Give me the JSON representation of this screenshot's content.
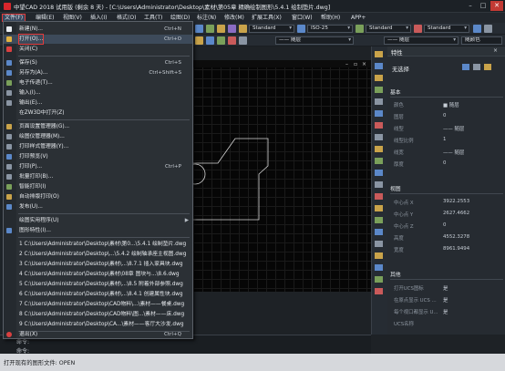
{
  "window": {
    "title": "中望CAD 2018 试用版 (剩余 8 天) - [C:\\Users\\Administrator\\Desktop\\素材\\第05章 精确绘制图形\\5.4.1 绘制垫片.dwg]",
    "minimize": "–",
    "maximize": "□",
    "close": "✕"
  },
  "menubar": {
    "items": [
      "文件(F)",
      "编辑(E)",
      "视图(V)",
      "插入(I)",
      "格式(O)",
      "工具(T)",
      "绘图(D)",
      "标注(N)",
      "修改(M)",
      "扩展工具(X)",
      "窗口(W)",
      "帮助(H)",
      "APP+"
    ]
  },
  "toolbar": {
    "text_style": "Standard",
    "dim_style": "ISO-25",
    "table_style": "Standard",
    "multileader_style": "Standard",
    "layer_linetype": "—— 随层",
    "layer_lineweight": "—— 随层",
    "color_value": "随颜色"
  },
  "file_menu": {
    "items": [
      {
        "label": "新建(N)...",
        "shortcut": "Ctrl+N",
        "icon": "new-file-icon"
      },
      {
        "label": "打开(O)...",
        "shortcut": "Ctrl+O",
        "icon": "open-folder-icon"
      },
      {
        "label": "关闭(C)",
        "shortcut": "",
        "icon": "close-file-icon"
      },
      {
        "label": "保存(S)",
        "shortcut": "Ctrl+S",
        "icon": "save-icon"
      },
      {
        "label": "另存为(A)...",
        "shortcut": "Ctrl+Shift+S",
        "icon": "save-as-icon"
      },
      {
        "label": "电子传递(T)...",
        "shortcut": "",
        "icon": "etransmit-icon"
      },
      {
        "label": "输入(I)...",
        "shortcut": "",
        "icon": "import-icon"
      },
      {
        "label": "输出(E)...",
        "shortcut": "",
        "icon": "export-icon"
      },
      {
        "label": "在ZW3D中打开(Z)",
        "shortcut": "",
        "icon": ""
      },
      {
        "label": "页面设置管理器(G)...",
        "shortcut": "",
        "icon": "page-setup-icon"
      },
      {
        "label": "绘图仪管理器(M)...",
        "shortcut": "",
        "icon": "plotter-icon"
      },
      {
        "label": "打印样式管理器(Y)...",
        "shortcut": "",
        "icon": "plot-style-icon"
      },
      {
        "label": "打印预览(V)",
        "shortcut": "",
        "icon": "preview-icon"
      },
      {
        "label": "打印(P)...",
        "shortcut": "Ctrl+P",
        "icon": "print-icon"
      },
      {
        "label": "批量打印(B)...",
        "shortcut": "",
        "icon": "batch-plot-icon"
      },
      {
        "label": "智能打印(I)",
        "shortcut": "",
        "icon": "smart-plot-icon"
      },
      {
        "label": "自动排版打印(O)",
        "shortcut": "",
        "icon": "auto-layout-plot-icon"
      },
      {
        "label": "发布(U)...",
        "shortcut": "",
        "icon": "publish-icon"
      },
      {
        "label": "绘图实用程序(U)",
        "shortcut": "",
        "icon": "",
        "submenu": true
      },
      {
        "label": "图形特性(I)...",
        "shortcut": "",
        "icon": "properties-icon"
      },
      {
        "label": "1 C:\\Users\\Administrator\\Desktop\\素材\\第0...\\5.4.1 绘制垫片.dwg",
        "shortcut": "",
        "icon": ""
      },
      {
        "label": "2 C:\\Users\\Administrator\\Desktop\\...\\5.4.2 绘制轴承座主视图.dwg",
        "shortcut": "",
        "icon": ""
      },
      {
        "label": "3 C:\\Users\\Administrator\\Desktop\\素材\\...\\8.7.1  插入家具块.dwg",
        "shortcut": "",
        "icon": ""
      },
      {
        "label": "4 C:\\Users\\Administrator\\Desktop\\素材\\08章 图块与...\\8.6.dwg",
        "shortcut": "",
        "icon": ""
      },
      {
        "label": "5 C:\\Users\\Administrator\\Desktop\\素材\\...\\8.5  附着外部参照.dwg",
        "shortcut": "",
        "icon": ""
      },
      {
        "label": "6 C:\\Users\\Administrator\\Desktop\\素材\\...\\8.4.1  创建属性块.dwg",
        "shortcut": "",
        "icon": ""
      },
      {
        "label": "7 C:\\Users\\Administrator\\Desktop\\CAD物料\\...\\素材——餐桌.dwg",
        "shortcut": "",
        "icon": ""
      },
      {
        "label": "8 C:\\Users\\Administrator\\Desktop\\CAD物料\\图...\\素材——床.dwg",
        "shortcut": "",
        "icon": ""
      },
      {
        "label": "9 C:\\Users\\Administrator\\Desktop\\CA...\\素材——客厅大沙发.dwg",
        "shortcut": "",
        "icon": ""
      },
      {
        "label": "退出(X)",
        "shortcut": "Ctrl+Q",
        "icon": "exit-icon"
      }
    ]
  },
  "properties_panel": {
    "title": "特性",
    "selection": "无选择",
    "section_basic": "基本",
    "basic": [
      {
        "label": "颜色",
        "value": "■ 随层"
      },
      {
        "label": "图层",
        "value": "0"
      },
      {
        "label": "线型",
        "value": "—— 随层"
      },
      {
        "label": "线型比例",
        "value": "1"
      },
      {
        "label": "线宽",
        "value": "—— 随层"
      },
      {
        "label": "厚度",
        "value": "0"
      }
    ],
    "section_view": "视图",
    "view": [
      {
        "label": "中心点 X",
        "value": "3922.2553"
      },
      {
        "label": "中心点 Y",
        "value": "2627.4662"
      },
      {
        "label": "中心点 Z",
        "value": "0"
      },
      {
        "label": "高度",
        "value": "4552.3278"
      },
      {
        "label": "宽度",
        "value": "8961.9494"
      }
    ],
    "section_misc": "其他",
    "misc": [
      {
        "label": "打开UCS图标",
        "value": "是"
      },
      {
        "label": "在原点显示 UCS ...",
        "value": "是"
      },
      {
        "label": "每个视口都显示 U...",
        "value": "是"
      },
      {
        "label": "UCS名称",
        "value": ""
      }
    ]
  },
  "command": {
    "line1": "命令:",
    "line2": "命令:"
  },
  "status": {
    "text": "打开现有的图形文件: OPEN"
  },
  "colors": {
    "menu_bg": "#2b3035",
    "highlight_border": "#e23a3a",
    "canvas_bg": "#060606",
    "panel_bg": "#262b31"
  }
}
